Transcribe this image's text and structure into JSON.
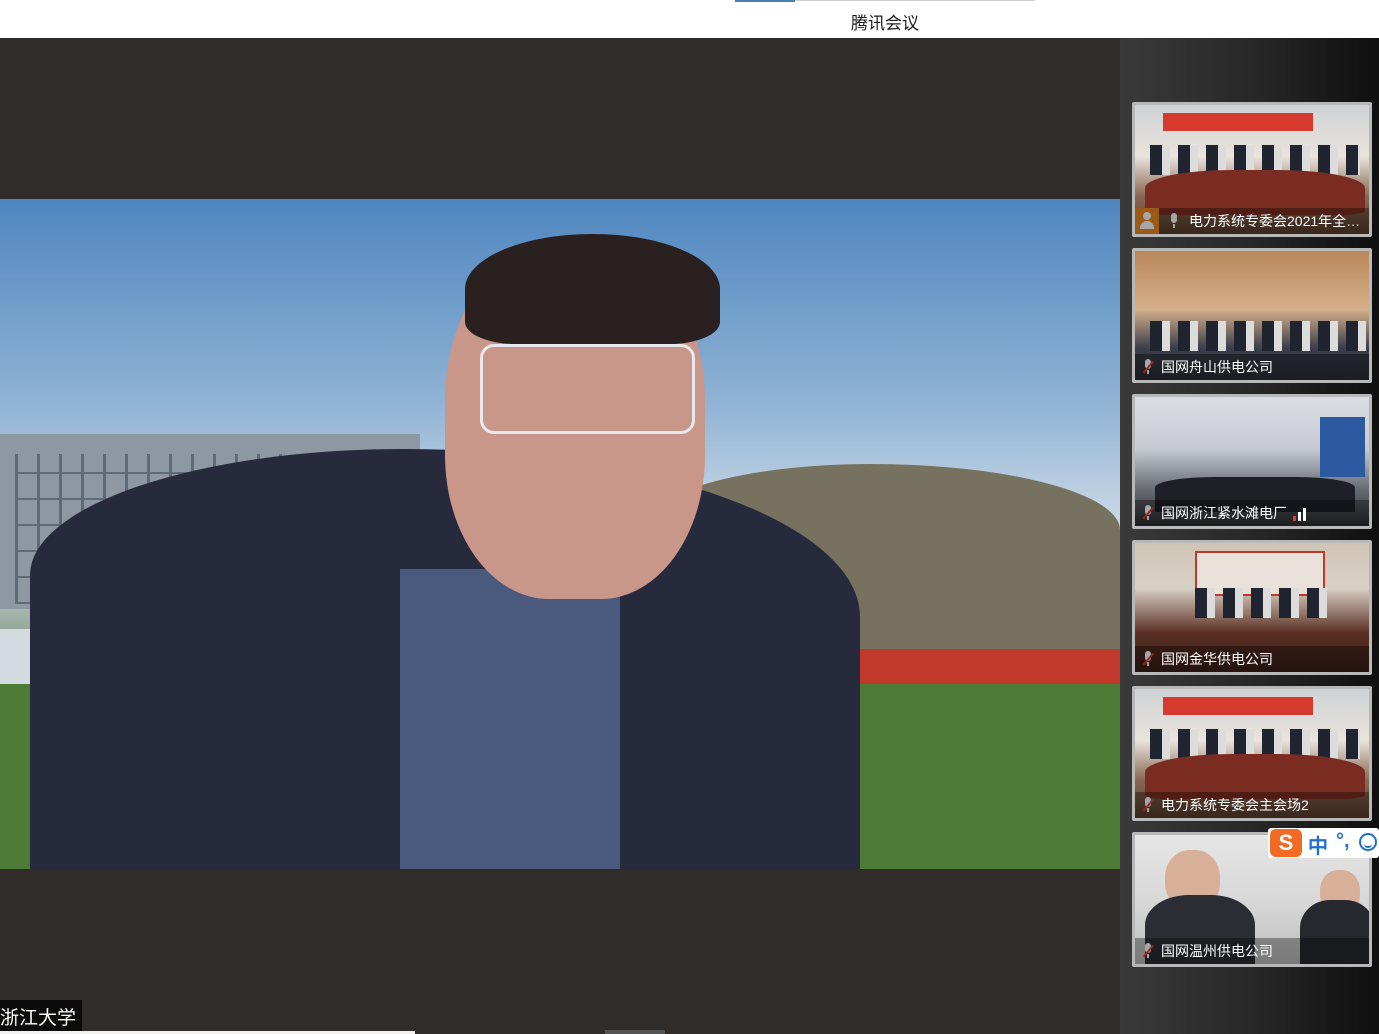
{
  "window": {
    "title": "腾讯会议"
  },
  "main_video": {
    "participant_name": "浙江大学"
  },
  "participants": [
    {
      "name": "电力系统专委会2021年全体...",
      "mic": "on"
    },
    {
      "name": "国网舟山供电公司",
      "mic": "muted"
    },
    {
      "name": "国网浙江紧水滩电厂",
      "mic": "muted"
    },
    {
      "name": "国网金华供电公司",
      "mic": "muted"
    },
    {
      "name": "电力系统专委会主会场2",
      "mic": "muted"
    },
    {
      "name": "国网温州供电公司",
      "mic": "muted"
    }
  ],
  "ime_toolbar": {
    "logo": "S",
    "mode": "中",
    "punct": "°,"
  },
  "colors": {
    "stage": "#2f2c2a",
    "accent": "#4a7fb0",
    "ime_orange": "#f26b25",
    "ime_blue": "#1f6fd1"
  }
}
